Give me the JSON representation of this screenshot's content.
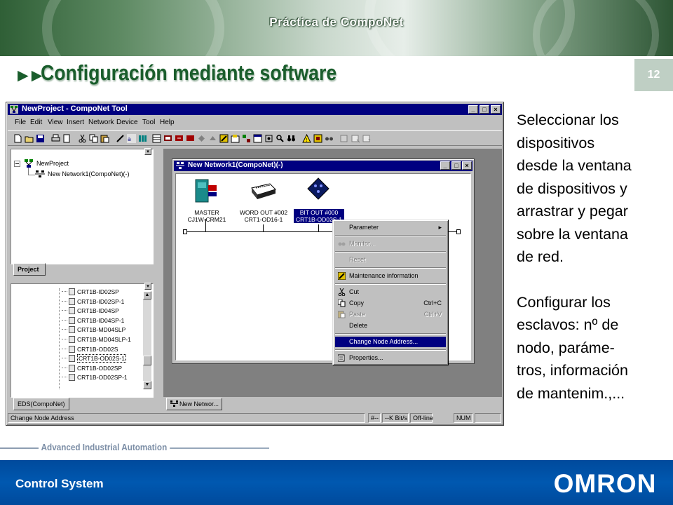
{
  "header": {
    "banner_title": "Práctica de CompoNet",
    "slide_title": "Configuración mediante software",
    "page_number": "12"
  },
  "app": {
    "window_title": "NewProject - CompoNet Tool",
    "menu": [
      "File",
      "Edit",
      "View",
      "Insert",
      "Network",
      "Device",
      "Tool",
      "Help"
    ],
    "project_tree": {
      "root": "NewProject",
      "child": "New Network1(CompoNet)(-)",
      "tab": "Project"
    },
    "eds_list": {
      "items": [
        "CRT1B-ID02SP",
        "CRT1B-ID02SP-1",
        "CRT1B-ID04SP",
        "CRT1B-ID04SP-1",
        "CRT1B-MD04SLP",
        "CRT1B-MD04SLP-1",
        "CRT1B-OD02S",
        "CRT1B-OD02S-1",
        "CRT1B-OD02SP",
        "CRT1B-OD02SP-1"
      ],
      "selected": "CRT1B-OD02S-1",
      "tab": "EDS(CompoNet)"
    },
    "network_window": {
      "title": "New Network1(CompoNet)(-)",
      "tab": "New Networ...",
      "devices": [
        {
          "line1": "MASTER",
          "line2": "CJ1W-CRM21",
          "selected": false,
          "icon": "master-unit-icon"
        },
        {
          "line1": "WORD OUT #002",
          "line2": "CRT1-OD16-1",
          "selected": false,
          "icon": "output-terminal-icon"
        },
        {
          "line1": "BIT OUT #000",
          "line2": "CRT1B-OD02S-1",
          "selected": true,
          "icon": "bit-slave-icon"
        }
      ]
    },
    "context_menu": {
      "items": [
        {
          "label": "Parameter",
          "shortcut": "",
          "disabled": false,
          "selected": false,
          "submenu": true
        },
        {
          "label": "Monitor...",
          "shortcut": "",
          "disabled": true,
          "selected": false
        },
        {
          "label": "Reset",
          "shortcut": "",
          "disabled": true,
          "selected": false
        },
        {
          "label": "Maintenance information",
          "shortcut": "",
          "disabled": false,
          "selected": false
        },
        {
          "label": "Cut",
          "shortcut": "",
          "disabled": false,
          "selected": false
        },
        {
          "label": "Copy",
          "shortcut": "Ctrl+C",
          "disabled": false,
          "selected": false
        },
        {
          "label": "Paste",
          "shortcut": "Ctrl+V",
          "disabled": true,
          "selected": false
        },
        {
          "label": "Delete",
          "shortcut": "",
          "disabled": false,
          "selected": false
        },
        {
          "label": "Change Node Address...",
          "shortcut": "",
          "disabled": false,
          "selected": true
        },
        {
          "label": "Properties...",
          "shortcut": "",
          "disabled": false,
          "selected": false
        }
      ]
    },
    "status_bar": {
      "message": "Change Node Address",
      "cells": [
        "#--",
        "--K Bit/s",
        "Off-line",
        "NUM"
      ]
    }
  },
  "body_text": {
    "paragraph1": "Seleccionar los\ndispositivos\ndesde la ventana\nde dispositivos y\narrastrar y pegar\nsobre la ventana\nde red.",
    "paragraph2": "Configurar los\nesclavos: nº de\nnodo, paráme-\ntros, información\nde mantenim.,..."
  },
  "footer": {
    "tagline": "Advanced Industrial Automation",
    "label": "Control System",
    "logo": "OMRON"
  },
  "colors": {
    "title_green": "#1a5d2c",
    "footer_blue": "#004a9c",
    "win_title_blue": "#000080"
  }
}
